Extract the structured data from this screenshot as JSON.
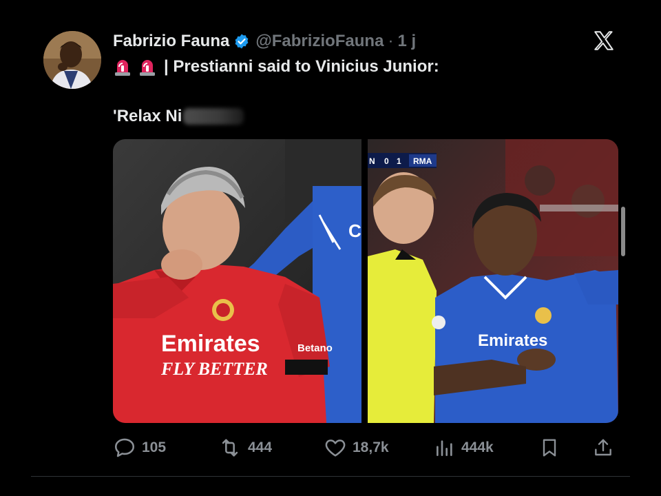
{
  "tweet": {
    "author_name": "Fabrizio Fauna",
    "handle": "@FabrizioFauna",
    "dot": "·",
    "time": "1 j",
    "line1": "| Prestianni said to Vinicius Junior:",
    "line2": "'Relax Ni",
    "media": {
      "scoreboard": {
        "left": "N",
        "home_score": "0",
        "away_score": "1",
        "away_team": "RMA"
      },
      "left_shirt_sponsor_line1": "Emirates",
      "left_shirt_sponsor_line2": "FLY BETTER",
      "left_shirt_side": "Betano",
      "right_shirt_sponsor": "Emirates"
    }
  },
  "actions": {
    "replies": "105",
    "reposts": "444",
    "likes": "18,7k",
    "views": "444k"
  },
  "icons": {
    "reply": "reply-icon",
    "repost": "repost-icon",
    "like": "heart-icon",
    "views": "views-icon",
    "bookmark": "bookmark-icon",
    "share": "share-icon",
    "verified": "verified-badge-icon",
    "siren": "siren-emoji-icon",
    "x": "x-logo-icon"
  },
  "colors": {
    "background": "#000000",
    "text": "#e7e9ea",
    "muted": "#71767b",
    "verified": "#1d9bf0"
  }
}
